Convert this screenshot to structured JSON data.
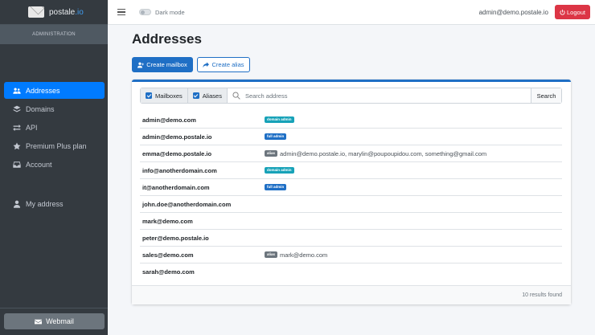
{
  "brand": {
    "name": "postale",
    "tld": ".io"
  },
  "sidebar": {
    "section_header": "ADMINISTRATION",
    "items": [
      {
        "label": "Addresses",
        "icon": "users-icon",
        "active": true
      },
      {
        "label": "Domains",
        "icon": "layers-icon",
        "active": false
      },
      {
        "label": "API",
        "icon": "exchange-icon",
        "active": false
      },
      {
        "label": "Premium Plus plan",
        "icon": "star-icon",
        "active": false
      },
      {
        "label": "Account",
        "icon": "inbox-icon",
        "active": false
      }
    ],
    "my_address": {
      "label": "My address",
      "icon": "user-icon"
    },
    "webmail": {
      "label": "Webmail",
      "icon": "envelope-icon"
    }
  },
  "topbar": {
    "dark_mode_label": "Dark mode",
    "user_email": "admin@demo.postale.io",
    "logout_label": "Logout"
  },
  "page": {
    "title": "Addresses",
    "create_mailbox_label": "Create mailbox",
    "create_alias_label": "Create alias"
  },
  "filters": {
    "mailboxes_label": "Mailboxes",
    "mailboxes_checked": true,
    "aliases_label": "Aliases",
    "aliases_checked": true,
    "search_placeholder": "Search address",
    "search_value": "",
    "search_button": "Search"
  },
  "addresses": [
    {
      "address": "admin@demo.com",
      "badge": "domain admin",
      "badge_type": "domain",
      "target": ""
    },
    {
      "address": "admin@demo.postale.io",
      "badge": "full admin",
      "badge_type": "full",
      "target": ""
    },
    {
      "address": "emma@demo.postale.io",
      "badge": "alias",
      "badge_type": "alias",
      "target": "admin@demo.postale.io, marylin@poupoupidou.com, something@gmail.com"
    },
    {
      "address": "info@anotherdomain.com",
      "badge": "domain admin",
      "badge_type": "domain",
      "target": ""
    },
    {
      "address": "it@anotherdomain.com",
      "badge": "full admin",
      "badge_type": "full",
      "target": ""
    },
    {
      "address": "john.doe@anotherdomain.com",
      "badge": "",
      "badge_type": "",
      "target": ""
    },
    {
      "address": "mark@demo.com",
      "badge": "",
      "badge_type": "",
      "target": ""
    },
    {
      "address": "peter@demo.postale.io",
      "badge": "",
      "badge_type": "",
      "target": ""
    },
    {
      "address": "sales@demo.com",
      "badge": "alias",
      "badge_type": "alias",
      "target": "mark@demo.com"
    },
    {
      "address": "sarah@demo.com",
      "badge": "",
      "badge_type": "",
      "target": ""
    }
  ],
  "footer": {
    "results_text": "10 results found"
  },
  "colors": {
    "primary": "#1f6fc5",
    "sidebar_bg": "#343a40",
    "danger": "#dc3545",
    "info": "#17a2b8",
    "secondary": "#6c757d"
  }
}
